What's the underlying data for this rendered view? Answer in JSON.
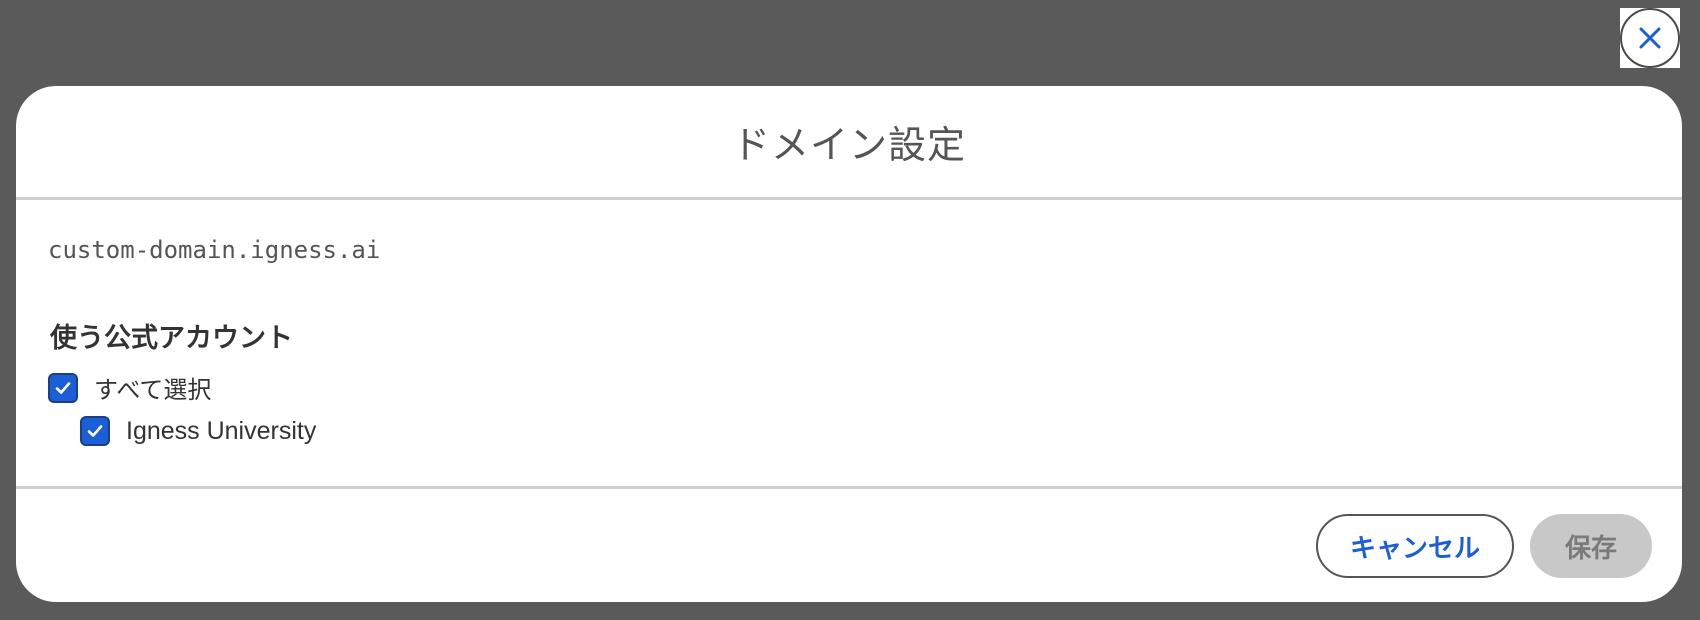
{
  "dialog": {
    "title": "ドメイン設定",
    "domain": "custom-domain.igness.ai",
    "section_label": "使う公式アカウント",
    "select_all": {
      "label": "すべて選択",
      "checked": true
    },
    "accounts": [
      {
        "label": "Igness University",
        "checked": true
      }
    ],
    "cancel_label": "キャンセル",
    "save_label": "保存",
    "save_disabled": true
  },
  "icons": {
    "close": "close-icon",
    "check": "check-icon"
  },
  "colors": {
    "overlay": "#5a5a5a",
    "accent": "#1a5fd6",
    "disabled_button": "#c8c8c8",
    "disabled_text": "#7a7a7a"
  }
}
